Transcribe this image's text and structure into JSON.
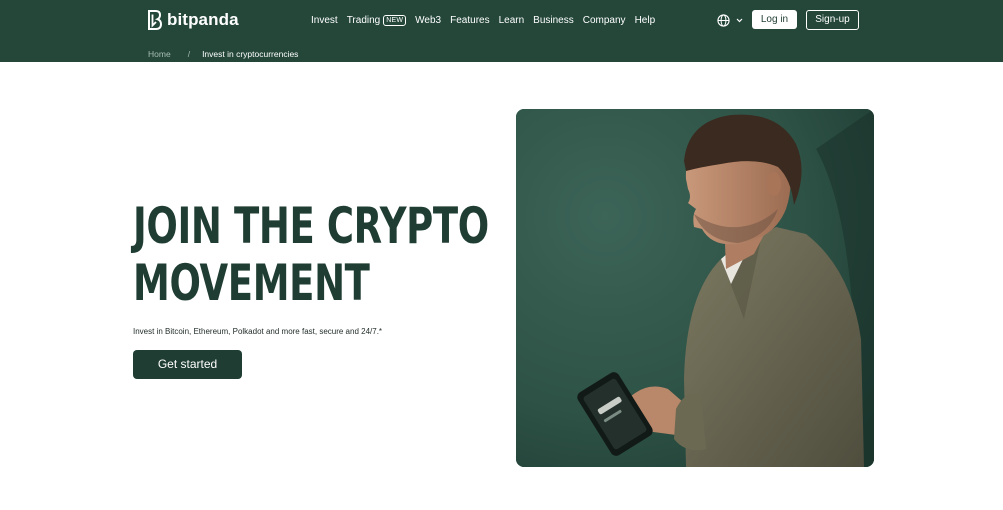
{
  "brand": {
    "name": "bitpanda"
  },
  "nav": {
    "items": [
      {
        "label": "Invest"
      },
      {
        "label": "Trading",
        "badge": "NEW"
      },
      {
        "label": "Web3"
      },
      {
        "label": "Features"
      },
      {
        "label": "Learn"
      },
      {
        "label": "Business"
      },
      {
        "label": "Company"
      },
      {
        "label": "Help"
      }
    ]
  },
  "header": {
    "language_icon": "globe-icon",
    "login_label": "Log in",
    "signup_label": "Sign-up"
  },
  "breadcrumb": {
    "home": "Home",
    "separator": "/",
    "current": "Invest in cryptocurrencies"
  },
  "hero": {
    "headline_line1": "JOIN THE CRYPTO",
    "headline_line2": "MOVEMENT",
    "subline": "Invest in Bitcoin, Ethereum, Polkadot and more fast, secure and 24/7.*",
    "cta_label": "Get started"
  },
  "colors": {
    "brand_green": "#24473a",
    "headline_green": "#1f3d32",
    "white": "#ffffff"
  }
}
